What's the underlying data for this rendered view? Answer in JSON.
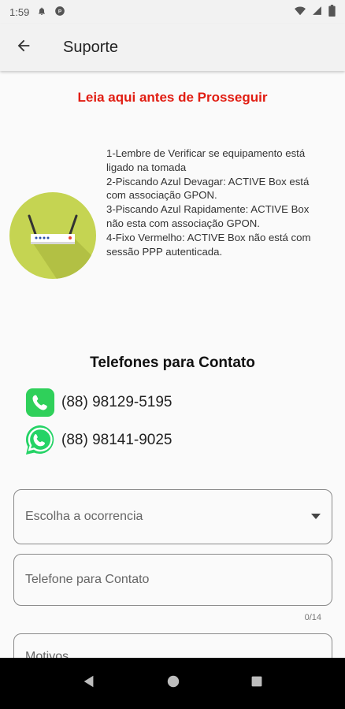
{
  "status_bar": {
    "time": "1:59"
  },
  "app_bar": {
    "title": "Suporte"
  },
  "warning_text": "Leia aqui antes de Prosseguir",
  "instructions": [
    "1-Lembre de Verificar se equipamento está ligado na tomada",
    "2-Piscando Azul Devagar: ACTIVE Box está com associação GPON.",
    "3-Piscando Azul Rapidamente: ACTIVE Box não esta com associação GPON.",
    "4-Fixo Vermelho: ACTIVE Box não está com sessão PPP autenticada."
  ],
  "contacts": {
    "title": "Telefones para Contato",
    "phone": "(88) 98129-5195",
    "whatsapp": "(88) 98141-9025"
  },
  "form": {
    "occurrence_placeholder": "Escolha a ocorrencia",
    "phone_placeholder": "Telefone para Contato",
    "phone_counter": "0/14",
    "reason_placeholder": "Motivos"
  },
  "colors": {
    "warning": "#e11d12",
    "router_bg": "#c5d452",
    "whatsapp_green": "#25d366"
  },
  "icons": {
    "back": "arrow-back-icon",
    "router": "router-icon",
    "phone": "phone-icon",
    "whatsapp": "whatsapp-icon",
    "dropdown": "dropdown-arrow-icon"
  }
}
